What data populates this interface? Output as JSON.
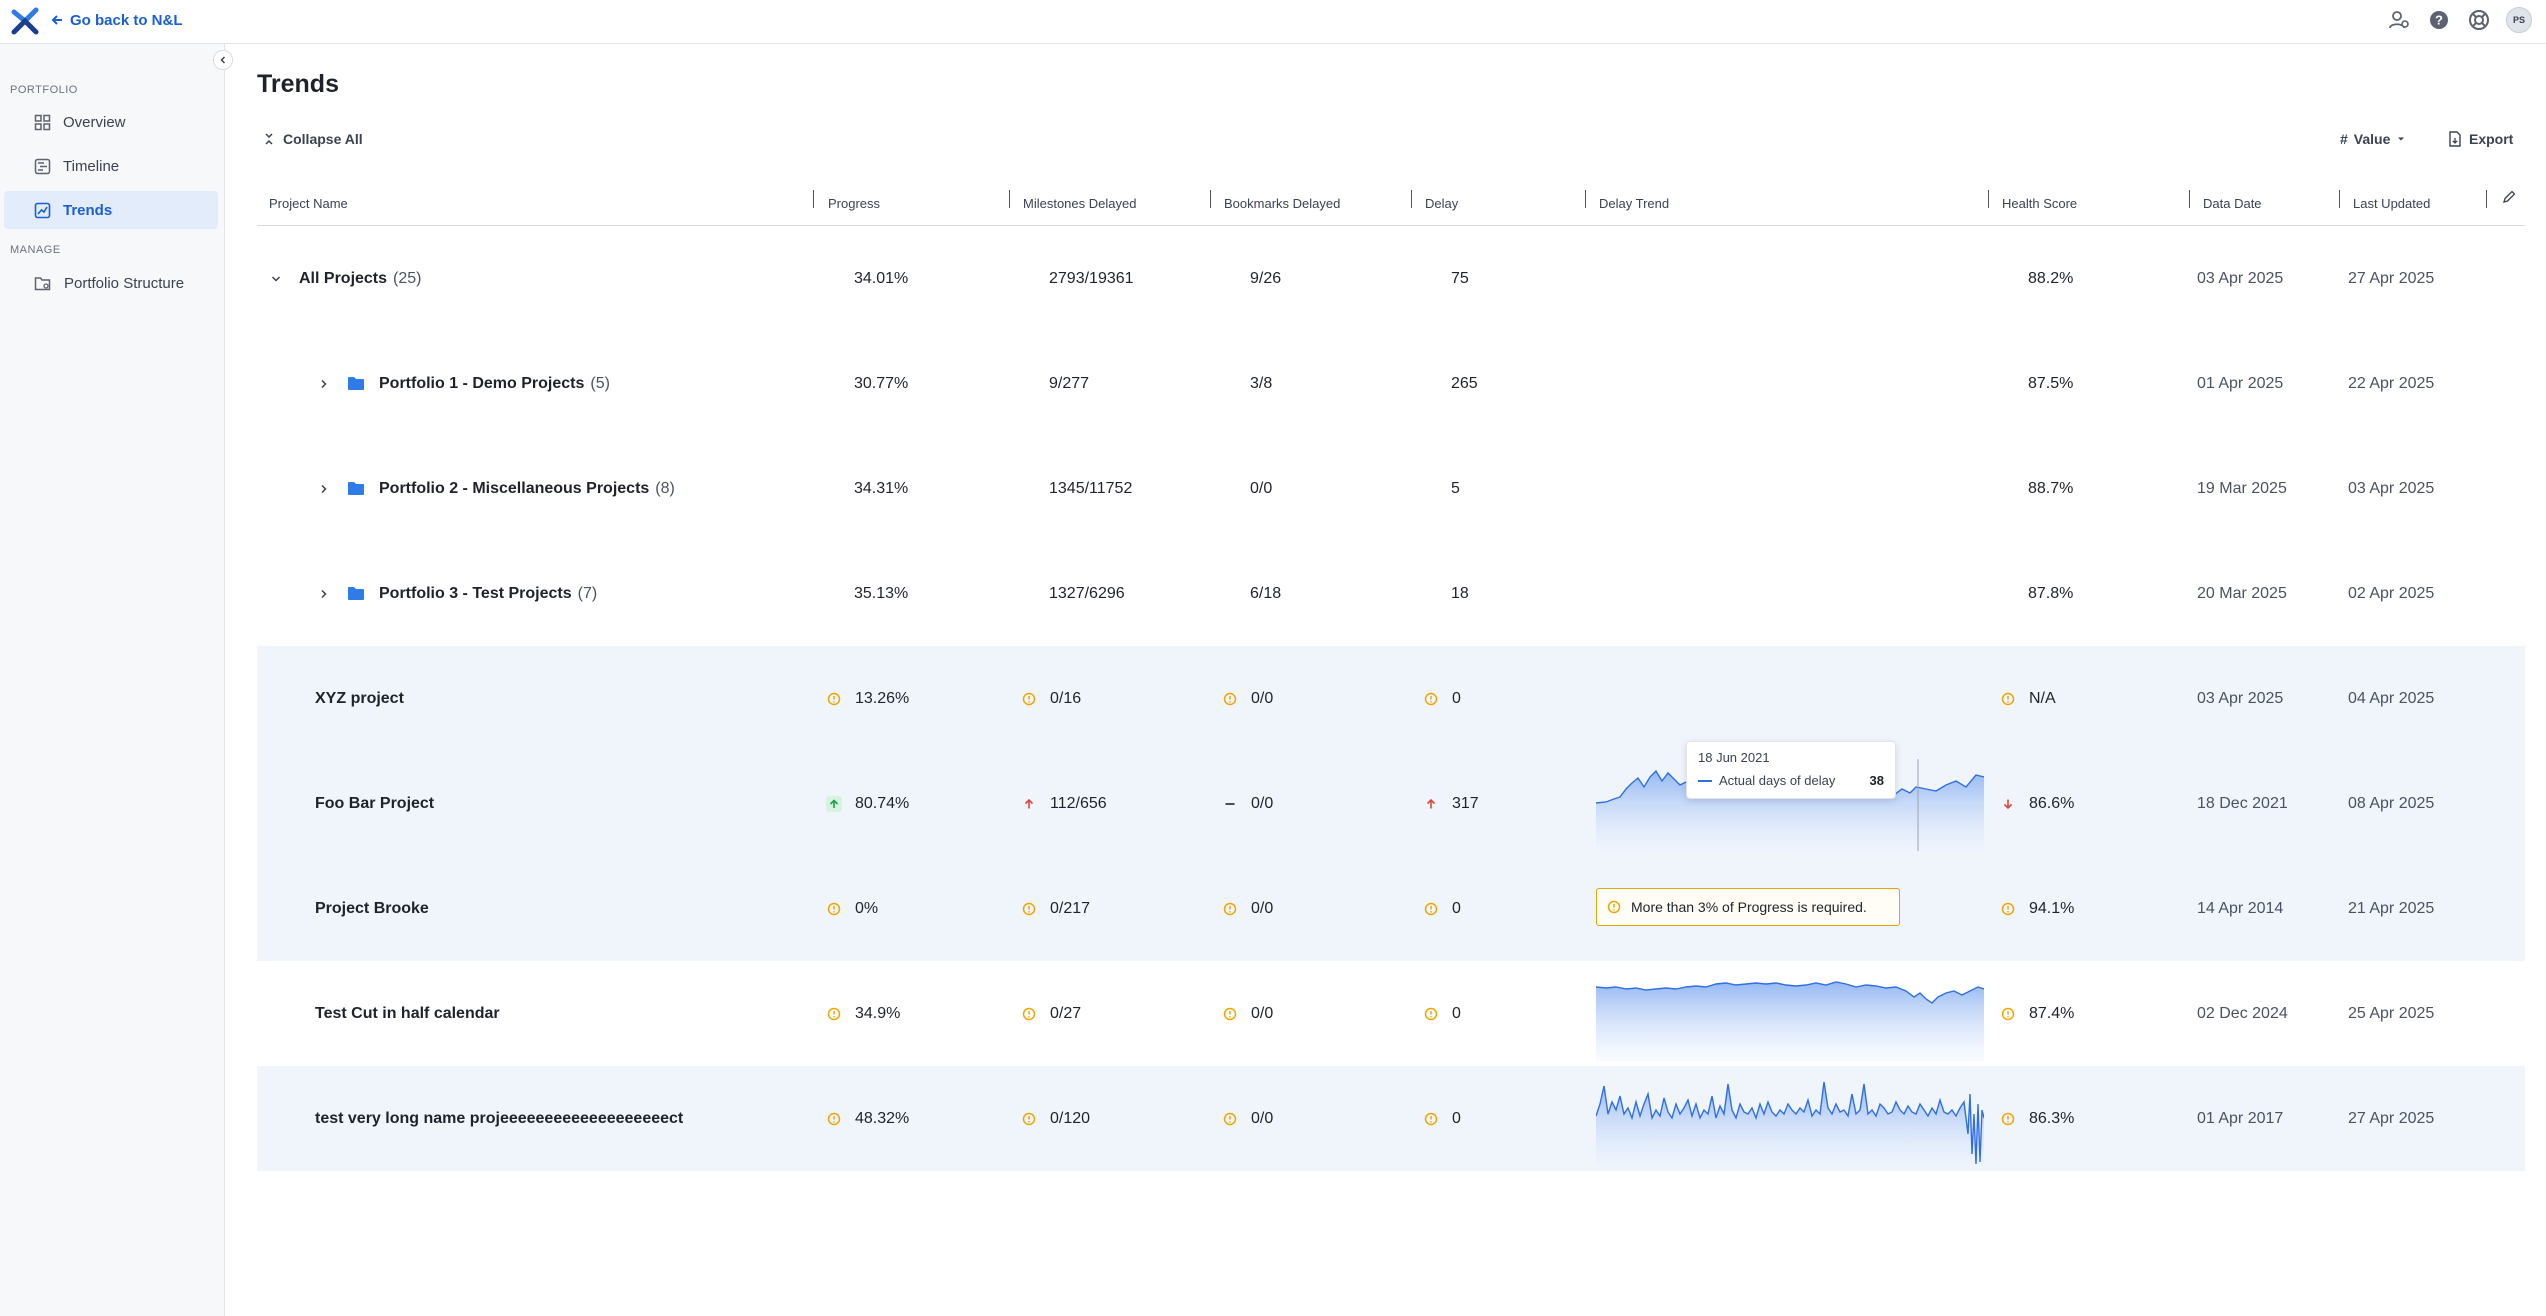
{
  "header": {
    "back_label": "Go back to N&L",
    "avatar_initials": "PS",
    "icons": [
      "user-settings-icon",
      "help-icon",
      "support-icon"
    ]
  },
  "sidebar": {
    "portfolio_label": "PORTFOLIO",
    "manage_label": "MANAGE",
    "items": [
      {
        "label": "Overview",
        "icon": "grid-icon",
        "active": false
      },
      {
        "label": "Timeline",
        "icon": "timeline-icon",
        "active": false
      },
      {
        "label": "Trends",
        "icon": "trends-icon",
        "active": true
      }
    ],
    "manage_items": [
      {
        "label": "Portfolio Structure",
        "icon": "folder-settings-icon"
      }
    ]
  },
  "main": {
    "title": "Trends",
    "collapse_all": "Collapse All",
    "value_select": "Value",
    "export": "Export"
  },
  "table": {
    "columns": [
      "Project Name",
      "Progress",
      "Milestones Delayed",
      "Bookmarks Delayed",
      "Delay",
      "Delay Trend",
      "Health Score",
      "Data Date",
      "Last Updated"
    ],
    "rows": [
      {
        "name": "All Projects",
        "count": "(25)",
        "progress": "34.01%",
        "milestones": "2793/19361",
        "bookmarks": "9/26",
        "delay": "75",
        "health": "88.2%",
        "data_date": "03 Apr 2025",
        "last_updated": "27 Apr 2025"
      },
      {
        "name": "Portfolio 1 - Demo Projects",
        "count": "(5)",
        "progress": "30.77%",
        "milestones": "9/277",
        "bookmarks": "3/8",
        "delay": "265",
        "health": "87.5%",
        "data_date": "01 Apr 2025",
        "last_updated": "22 Apr 2025"
      },
      {
        "name": "Portfolio 2 - Miscellaneous Projects",
        "count": "(8)",
        "progress": "34.31%",
        "milestones": "1345/11752",
        "bookmarks": "0/0",
        "delay": "5",
        "health": "88.7%",
        "data_date": "19 Mar 2025",
        "last_updated": "03 Apr 2025"
      },
      {
        "name": "Portfolio 3 - Test Projects",
        "count": "(7)",
        "progress": "35.13%",
        "milestones": "1327/6296",
        "bookmarks": "6/18",
        "delay": "18",
        "health": "87.8%",
        "data_date": "20 Mar 2025",
        "last_updated": "02 Apr 2025"
      },
      {
        "name": "XYZ project",
        "progress": "13.26%",
        "milestones": "0/16",
        "bookmarks": "0/0",
        "delay": "0",
        "health": "N/A",
        "data_date": "03 Apr 2025",
        "last_updated": "04 Apr 2025"
      },
      {
        "name": "Foo Bar Project",
        "progress": "80.74%",
        "milestones": "112/656",
        "bookmarks": "0/0",
        "delay": "317",
        "health": "86.6%",
        "data_date": "18 Dec 2021",
        "last_updated": "08 Apr 2025"
      },
      {
        "name": "Project Brooke",
        "progress": "0%",
        "milestones": "0/217",
        "bookmarks": "0/0",
        "delay": "0",
        "health": "94.1%",
        "data_date": "14 Apr 2014",
        "last_updated": "21 Apr 2025"
      },
      {
        "name": "Test Cut in half calendar",
        "progress": "34.9%",
        "milestones": "0/27",
        "bookmarks": "0/0",
        "delay": "0",
        "health": "87.4%",
        "data_date": "02 Dec 2024",
        "last_updated": "25 Apr 2025"
      },
      {
        "name": "test very long name projeeeeeeeeeeeeeeeeeeect",
        "progress": "48.32%",
        "milestones": "0/120",
        "bookmarks": "0/0",
        "delay": "0",
        "health": "86.3%",
        "data_date": "01 Apr 2017",
        "last_updated": "27 Apr 2025"
      }
    ]
  },
  "tooltip": {
    "date": "18 Jun 2021",
    "series": "Actual days of delay",
    "value": "38"
  },
  "warning": {
    "text": "More than 3% of Progress is required."
  },
  "colors": {
    "accent": "#1a5fd6",
    "active_bg": "#e3ecfb",
    "warn": "#f0a500",
    "up_red": "#e0453a",
    "up_green": "#1e9e4a",
    "spark_line": "#2f6fe4"
  }
}
